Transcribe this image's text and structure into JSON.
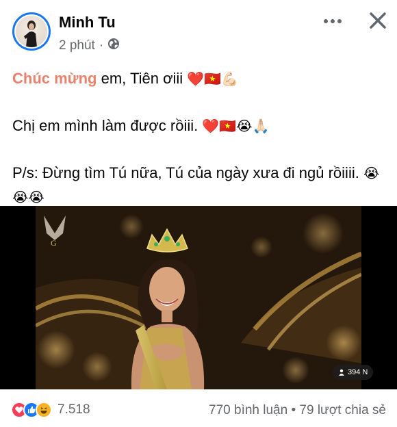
{
  "post": {
    "author": "Minh Tu",
    "time": "2 phút",
    "audience_icon": "globe-icon",
    "line1_highlight": "Chúc mừng",
    "line1_text": " em, Tiên ơiii ",
    "line1_emoji": "❤️🇻🇳💪🏻",
    "line2_text": "Chị em mình làm được rồiii. ",
    "line2_emoji": "❤️🇻🇳😭🙏🏻",
    "line3_text": "P/s: Đừng tìm Tú nữa, Tú của ngày xưa đi ngủ rồiiii. ",
    "line3_emoji": "😭😭😭"
  },
  "media": {
    "views": "394 N"
  },
  "footer": {
    "reaction_count": "7.518",
    "comments": "770 bình luận",
    "separator": " • ",
    "shares": "79 lượt chia sẻ"
  }
}
